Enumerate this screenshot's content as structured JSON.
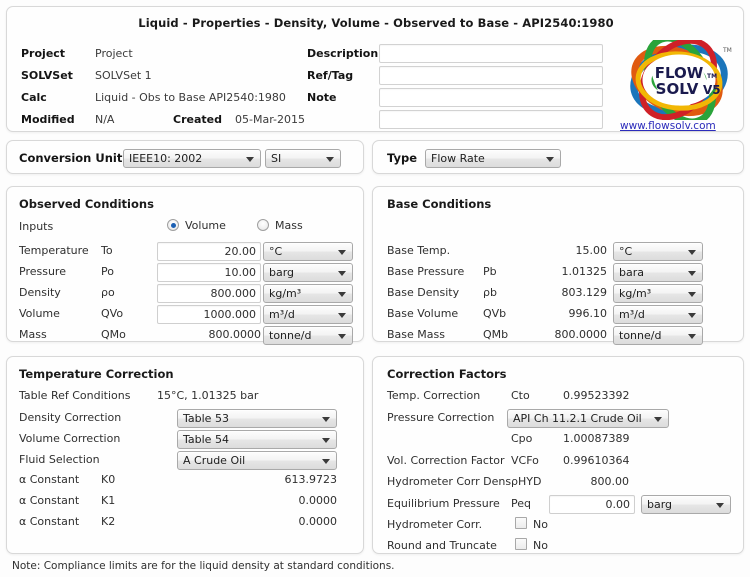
{
  "window": {
    "title": "Liquid - Properties - Density, Volume - Observed to Base - API2540:1980"
  },
  "header": {
    "fields": [
      {
        "label": "Project",
        "value": "Project"
      },
      {
        "label": "SOLVSet",
        "value": "SOLVSet 1"
      },
      {
        "label": "Calc",
        "value": "Liquid - Obs to Base API2540:1980"
      },
      {
        "label": "Modified",
        "value": "N/A"
      }
    ],
    "created_label": "Created",
    "created_value": "05-Mar-2015",
    "right_fields": [
      {
        "label": "Description",
        "value": "",
        "placeholder": ""
      },
      {
        "label": "Ref/Tag",
        "value": "",
        "placeholder": ""
      },
      {
        "label": "Note",
        "value": "",
        "placeholder": ""
      },
      {
        "label": "",
        "value": "",
        "placeholder": ""
      }
    ],
    "logo": {
      "line1": "FLOW",
      "line1_sub": "TM",
      "line2": "SOLV",
      "line2_sub": "V5",
      "tm": "TM",
      "url": "www.flowsolv.com",
      "colors": {
        "blue": "#1b75bb",
        "orange": "#e05a10",
        "green": "#2aa33a",
        "red": "#cf2027",
        "yellow": "#f2b705"
      }
    }
  },
  "conversion_bar": {
    "label": "Conversion Unit",
    "standard": "IEEE10: 2002",
    "system": "SI"
  },
  "type_bar": {
    "label": "Type",
    "value": "Flow Rate"
  },
  "observed": {
    "title": "Observed Conditions",
    "inputs_label": "Inputs",
    "radios": [
      {
        "label": "Volume",
        "selected": true
      },
      {
        "label": "Mass",
        "selected": false
      }
    ],
    "rows": [
      {
        "label": "Temperature",
        "symbol": "To",
        "value": "20.00",
        "unit": "°C",
        "editable": true
      },
      {
        "label": "Pressure",
        "symbol": "Po",
        "value": "10.00",
        "unit": "barg",
        "editable": true
      },
      {
        "label": "Density",
        "symbol": "ρo",
        "value": "800.000",
        "unit": "kg/m³",
        "editable": true
      },
      {
        "label": "Volume",
        "symbol": "QVo",
        "value": "1000.000",
        "unit": "m³/d",
        "editable": true
      },
      {
        "label": "Mass",
        "symbol": "QMo",
        "value": "800.0000",
        "unit": "tonne/d",
        "editable": false
      }
    ]
  },
  "base": {
    "title": "Base Conditions",
    "rows": [
      {
        "label": "Base Temp.",
        "symbol": "",
        "value": "15.00",
        "unit": "°C"
      },
      {
        "label": "Base Pressure",
        "symbol": "Pb",
        "value": "1.01325",
        "unit": "bara"
      },
      {
        "label": "Base Density",
        "symbol": "ρb",
        "value": "803.129",
        "unit": "kg/m³"
      },
      {
        "label": "Base Volume",
        "symbol": "QVb",
        "value": "996.10",
        "unit": "m³/d"
      },
      {
        "label": "Base Mass",
        "symbol": "QMb",
        "value": "800.0000",
        "unit": "tonne/d"
      }
    ]
  },
  "temp_correction": {
    "title": "Temperature Correction",
    "table_ref_label": "Table Ref Conditions",
    "table_ref_value": "15°C, 1.01325 bar",
    "density_correction_label": "Density Correction",
    "density_correction_value": "Table 53",
    "volume_correction_label": "Volume Correction",
    "volume_correction_value": "Table 54",
    "fluid_selection_label": "Fluid Selection",
    "fluid_selection_value": "A Crude Oil",
    "constants": [
      {
        "label": "α Constant",
        "symbol": "K0",
        "value": "613.9723"
      },
      {
        "label": "α Constant",
        "symbol": "K1",
        "value": "0.0000"
      },
      {
        "label": "α Constant",
        "symbol": "K2",
        "value": "0.0000"
      }
    ]
  },
  "correction_factors": {
    "title": "Correction Factors",
    "temp_corr_label": "Temp. Correction",
    "temp_corr_symbol": "Cto",
    "temp_corr_value": "0.99523392",
    "press_corr_label": "Pressure Correction",
    "press_corr_value": "API Ch 11.2.1 Crude Oil",
    "cpo_symbol": "Cpo",
    "cpo_value": "1.00087389",
    "vcf_label": "Vol. Correction Factor",
    "vcf_symbol": "VCFo",
    "vcf_value": "0.99610364",
    "hyd_dens_label": "Hydrometer Corr Dens",
    "hyd_dens_symbol": "ρHYD",
    "hyd_dens_value": "800.00",
    "peq_label": "Equilibrium Pressure",
    "peq_symbol": "Peq",
    "peq_value": "0.00",
    "peq_unit": "barg",
    "hyd_corr_label": "Hydrometer Corr.",
    "hyd_corr_state": "No",
    "round_trunc_label": "Round and Truncate",
    "round_trunc_state": "No"
  },
  "footer": {
    "note": "Note: Compliance limits are for the liquid density at standard conditions."
  }
}
